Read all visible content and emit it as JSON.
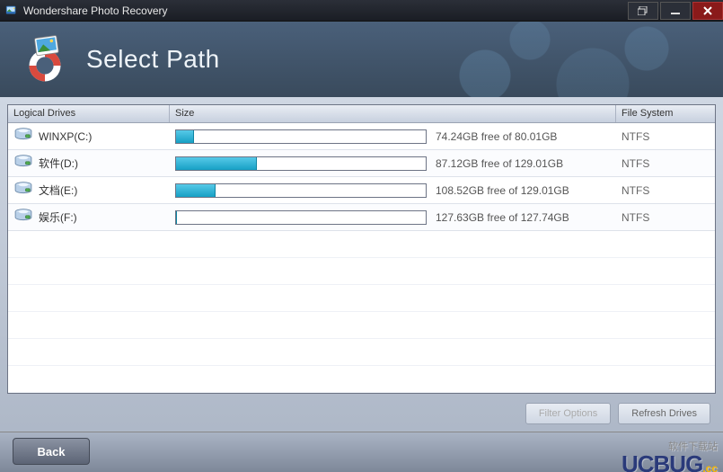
{
  "window": {
    "title": "Wondershare Photo Recovery"
  },
  "header": {
    "title": "Select Path"
  },
  "columns": {
    "drives": "Logical Drives",
    "size": "Size",
    "fs": "File System"
  },
  "drives": [
    {
      "label": "WINXP(C:)",
      "used_pct": 7.2,
      "free_text": "74.24GB free of 80.01GB",
      "fs": "NTFS"
    },
    {
      "label": "软件(D:)",
      "used_pct": 32.5,
      "free_text": "87.12GB free of 129.01GB",
      "fs": "NTFS"
    },
    {
      "label": "文档(E:)",
      "used_pct": 15.9,
      "free_text": "108.52GB free of 129.01GB",
      "fs": "NTFS"
    },
    {
      "label": "娱乐(F:)",
      "used_pct": 0.1,
      "free_text": "127.63GB free of 127.74GB",
      "fs": "NTFS"
    }
  ],
  "buttons": {
    "filter": "Filter Options",
    "refresh": "Refresh Drives",
    "back": "Back"
  },
  "watermark": {
    "sub": "软件下载站",
    "main": "UCBUG",
    "suffix": ".cc"
  }
}
